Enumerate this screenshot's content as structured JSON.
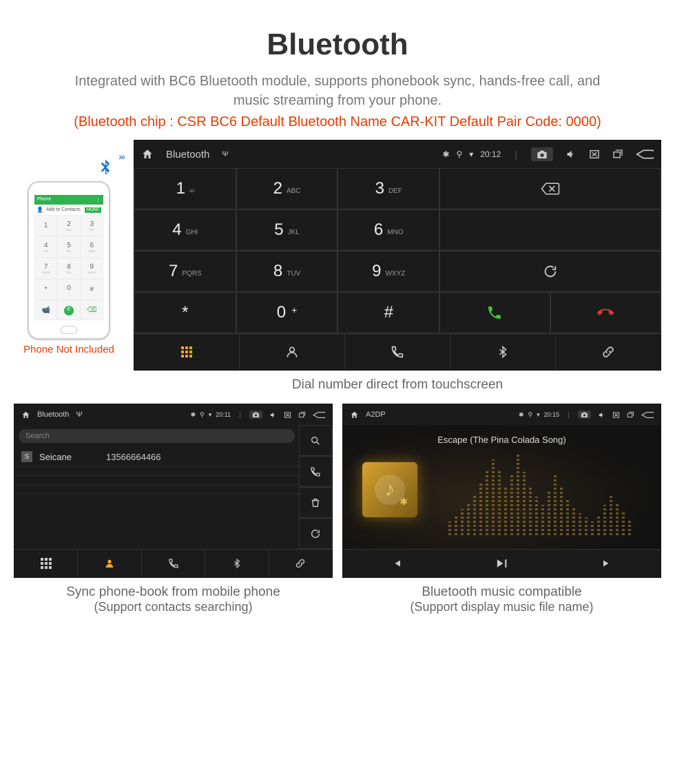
{
  "header": {
    "title": "Bluetooth",
    "subtitle": "Integrated with BC6 Bluetooth module, supports phonebook sync, hands-free call, and music streaming from your phone.",
    "meta": "(Bluetooth chip : CSR BC6     Default Bluetooth Name CAR-KIT     Default Pair Code: 0000)"
  },
  "phone": {
    "caption": "Phone Not Included",
    "header_left": "Phone",
    "header_right": "⋮",
    "add_label": "Add to Contacts",
    "add_more": "MORE",
    "keys": [
      {
        "d": "1",
        "s": ""
      },
      {
        "d": "2",
        "s": "ABC"
      },
      {
        "d": "3",
        "s": "DEF"
      },
      {
        "d": "4",
        "s": "GHI"
      },
      {
        "d": "5",
        "s": "JKL"
      },
      {
        "d": "6",
        "s": "MNO"
      },
      {
        "d": "7",
        "s": "PQRS"
      },
      {
        "d": "8",
        "s": "TUV"
      },
      {
        "d": "9",
        "s": "WXYZ"
      },
      {
        "d": "*",
        "s": ""
      },
      {
        "d": "0",
        "s": "+"
      },
      {
        "d": "#",
        "s": ""
      }
    ]
  },
  "dialer": {
    "statusbar": {
      "title": "Bluetooth",
      "time": "20:12"
    },
    "keys": [
      {
        "d": "1",
        "s": "∞"
      },
      {
        "d": "2",
        "s": "ABC"
      },
      {
        "d": "3",
        "s": "DEF"
      },
      {
        "d": "4",
        "s": "GHI"
      },
      {
        "d": "5",
        "s": "JKL"
      },
      {
        "d": "6",
        "s": "MNO"
      },
      {
        "d": "7",
        "s": "PQRS"
      },
      {
        "d": "8",
        "s": "TUV"
      },
      {
        "d": "9",
        "s": "WXYZ"
      },
      {
        "d": "*",
        "s": ""
      },
      {
        "d": "0",
        "s": "+",
        "sup": true
      },
      {
        "d": "#",
        "s": ""
      }
    ],
    "caption": "Dial number direct from touchscreen"
  },
  "phonebook": {
    "statusbar": {
      "title": "Bluetooth",
      "time": "20:11"
    },
    "search_placeholder": "Search",
    "contact": {
      "badge": "S",
      "name": "Seicane",
      "number": "13566664466"
    },
    "caption_l1": "Sync phone-book from mobile phone",
    "caption_l2": "(Support contacts searching)"
  },
  "a2dp": {
    "statusbar": {
      "title": "A2DP",
      "time": "20:15"
    },
    "song": "Escape (The Pina Colada Song)",
    "viz": [
      20,
      30,
      38,
      48,
      60,
      78,
      96,
      110,
      96,
      70,
      88,
      118,
      92,
      70,
      56,
      44,
      66,
      90,
      72,
      54,
      40,
      32,
      26,
      20,
      30,
      44,
      58,
      46,
      34,
      24
    ],
    "caption_l1": "Bluetooth music compatible",
    "caption_l2": "(Support display music file name)"
  }
}
